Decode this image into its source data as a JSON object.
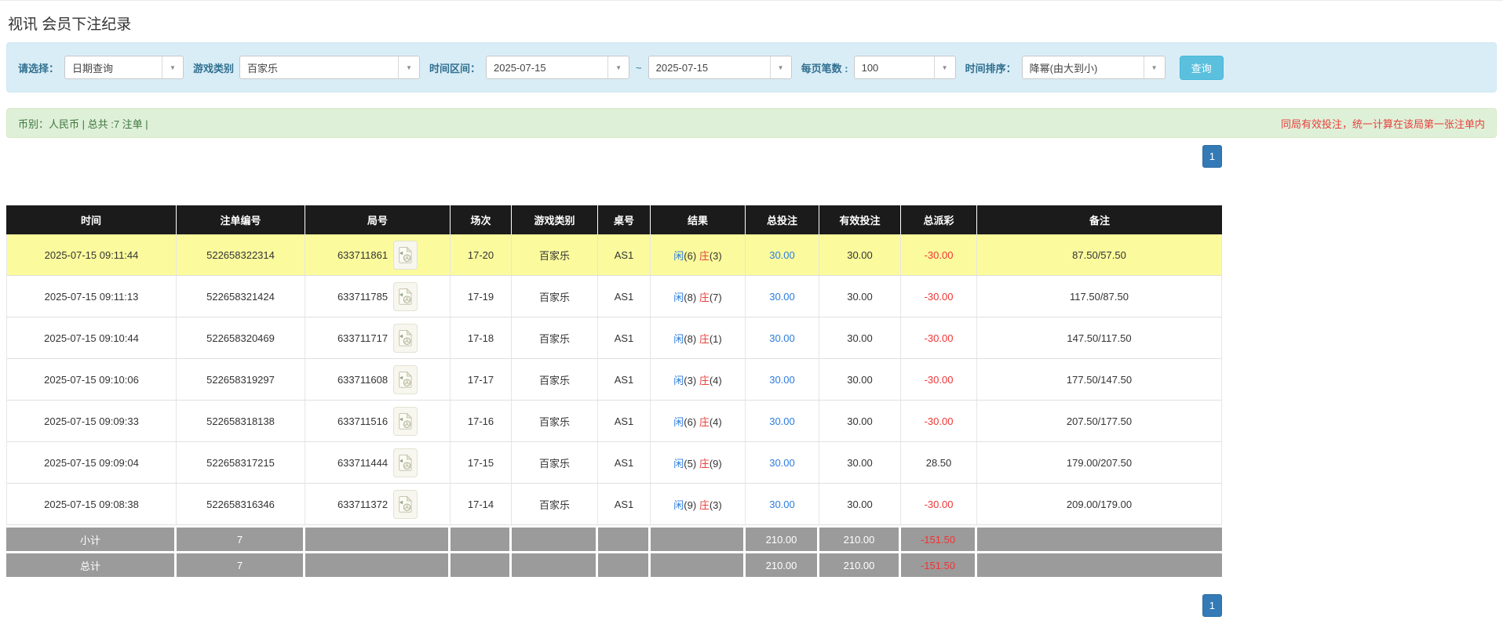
{
  "page": {
    "title": "视讯 会员下注纪录"
  },
  "filters": {
    "select_label": "请选择：",
    "select_value": "日期查询",
    "game_type_label": "游戏类别",
    "game_type_value": "百家乐",
    "time_range_label": "时间区间：",
    "date_from": "2025-07-15",
    "tilde": "~",
    "date_to": "2025-07-15",
    "page_size_label": "每页笔数 :",
    "page_size_value": "100",
    "sort_label": "时间排序：",
    "sort_value": "降幂(由大到小)",
    "search_button": "查询"
  },
  "summary": {
    "left": "币别：人民币 | 总共 :7 注单 |",
    "right": "同局有效投注，统一计算在该局第一张注单内"
  },
  "pagination": {
    "page": "1"
  },
  "table": {
    "headers": [
      "时间",
      "注单编号",
      "局号",
      "场次",
      "游戏类别",
      "桌号",
      "结果",
      "总投注",
      "有效投注",
      "总派彩",
      "备注"
    ],
    "rows": [
      {
        "time": "2025-07-15 09:11:44",
        "bet_no": "522658322314",
        "round_no": "633711861",
        "session": "17-20",
        "game": "百家乐",
        "table_no": "AS1",
        "result": {
          "player": "闲",
          "player_score": "(6)",
          "banker": "庄",
          "banker_score": "(3)"
        },
        "total_bet": "30.00",
        "valid_bet": "30.00",
        "payout": "-30.00",
        "remark": "87.50/57.50",
        "highlight": true
      },
      {
        "time": "2025-07-15 09:11:13",
        "bet_no": "522658321424",
        "round_no": "633711785",
        "session": "17-19",
        "game": "百家乐",
        "table_no": "AS1",
        "result": {
          "player": "闲",
          "player_score": "(8)",
          "banker": "庄",
          "banker_score": "(7)"
        },
        "total_bet": "30.00",
        "valid_bet": "30.00",
        "payout": "-30.00",
        "remark": "117.50/87.50",
        "highlight": false
      },
      {
        "time": "2025-07-15 09:10:44",
        "bet_no": "522658320469",
        "round_no": "633711717",
        "session": "17-18",
        "game": "百家乐",
        "table_no": "AS1",
        "result": {
          "player": "闲",
          "player_score": "(8)",
          "banker": "庄",
          "banker_score": "(1)"
        },
        "total_bet": "30.00",
        "valid_bet": "30.00",
        "payout": "-30.00",
        "remark": "147.50/117.50",
        "highlight": false
      },
      {
        "time": "2025-07-15 09:10:06",
        "bet_no": "522658319297",
        "round_no": "633711608",
        "session": "17-17",
        "game": "百家乐",
        "table_no": "AS1",
        "result": {
          "player": "闲",
          "player_score": "(3)",
          "banker": "庄",
          "banker_score": "(4)"
        },
        "total_bet": "30.00",
        "valid_bet": "30.00",
        "payout": "-30.00",
        "remark": "177.50/147.50",
        "highlight": false
      },
      {
        "time": "2025-07-15 09:09:33",
        "bet_no": "522658318138",
        "round_no": "633711516",
        "session": "17-16",
        "game": "百家乐",
        "table_no": "AS1",
        "result": {
          "player": "闲",
          "player_score": "(6)",
          "banker": "庄",
          "banker_score": "(4)"
        },
        "total_bet": "30.00",
        "valid_bet": "30.00",
        "payout": "-30.00",
        "remark": "207.50/177.50",
        "highlight": false
      },
      {
        "time": "2025-07-15 09:09:04",
        "bet_no": "522658317215",
        "round_no": "633711444",
        "session": "17-15",
        "game": "百家乐",
        "table_no": "AS1",
        "result": {
          "player": "闲",
          "player_score": "(5)",
          "banker": "庄",
          "banker_score": "(9)"
        },
        "total_bet": "30.00",
        "valid_bet": "30.00",
        "payout": "28.50",
        "remark": "179.00/207.50",
        "highlight": false
      },
      {
        "time": "2025-07-15 09:08:38",
        "bet_no": "522658316346",
        "round_no": "633711372",
        "session": "17-14",
        "game": "百家乐",
        "table_no": "AS1",
        "result": {
          "player": "闲",
          "player_score": "(9)",
          "banker": "庄",
          "banker_score": "(3)"
        },
        "total_bet": "30.00",
        "valid_bet": "30.00",
        "payout": "-30.00",
        "remark": "209.00/179.00",
        "highlight": false
      }
    ],
    "subtotal": {
      "label": "小计",
      "count": "7",
      "total_bet": "210.00",
      "valid_bet": "210.00",
      "payout": "-151.50"
    },
    "total": {
      "label": "总计",
      "count": "7",
      "total_bet": "210.00",
      "valid_bet": "210.00",
      "payout": "-151.50"
    }
  },
  "icons": {
    "dropdown_arrow": "chevron-down",
    "round_video": "video-replay-file"
  },
  "colors": {
    "filter_bg": "#d9edf7",
    "filter_label": "#31708f",
    "search_btn_bg": "#5bc0de",
    "summary_green_bg": "#dff0d8",
    "summary_green_text": "#3c763d",
    "notice_red": "#e8403d",
    "pager_active_bg": "#337ab7",
    "header_bg": "#1b1b1b",
    "highlight_yellow": "#fbfb9d",
    "accent_blue": "#2a7cdf",
    "banker_red": "#e8403d",
    "negative_red": "#f03434",
    "subtotal_bg": "#9b9b9b"
  }
}
